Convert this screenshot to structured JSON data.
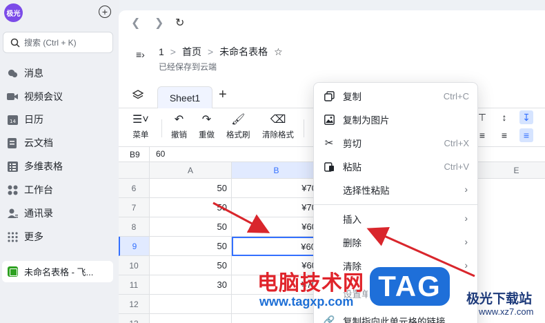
{
  "sidebar": {
    "avatar": "极光",
    "search_placeholder": "搜索 (Ctrl + K)",
    "items": [
      {
        "label": "消息",
        "icon": "chat-icon"
      },
      {
        "label": "视频会议",
        "icon": "video-icon"
      },
      {
        "label": "日历",
        "icon": "calendar-icon"
      },
      {
        "label": "云文档",
        "icon": "cloud-doc-icon"
      },
      {
        "label": "多维表格",
        "icon": "bitable-icon"
      },
      {
        "label": "工作台",
        "icon": "workspace-icon"
      },
      {
        "label": "通讯录",
        "icon": "contacts-icon"
      },
      {
        "label": "更多",
        "icon": "more-icon"
      }
    ],
    "recent_doc": "未命名表格 - 飞..."
  },
  "header": {
    "breadcrumb_num": "1",
    "breadcrumb_home": "首页",
    "breadcrumb_sep": ">",
    "doc_title": "未命名表格",
    "saved_status": "已经保存到云端"
  },
  "tabs": {
    "sheet_name": "Sheet1",
    "add": "+"
  },
  "toolbar": {
    "menu": "菜单",
    "undo": "撤销",
    "redo": "重做",
    "format_painter": "格式刷",
    "clear_format": "清除格式"
  },
  "formula": {
    "cell_ref": "B9",
    "value": "60"
  },
  "grid": {
    "columns": [
      "A",
      "B",
      "E"
    ],
    "rows": [
      {
        "num": "6",
        "a": "50",
        "b": "¥70"
      },
      {
        "num": "7",
        "a": "50",
        "b": "¥70"
      },
      {
        "num": "8",
        "a": "50",
        "b": "¥60"
      },
      {
        "num": "9",
        "a": "50",
        "b": "¥60"
      },
      {
        "num": "10",
        "a": "50",
        "b": "¥60"
      },
      {
        "num": "11",
        "a": "30",
        "b": "¥70"
      },
      {
        "num": "12",
        "a": "",
        "b": ""
      },
      {
        "num": "13",
        "a": "",
        "b": ""
      }
    ]
  },
  "context_menu": {
    "copy": "复制",
    "copy_sc": "Ctrl+C",
    "copy_as_image": "复制为图片",
    "cut": "剪切",
    "cut_sc": "Ctrl+X",
    "paste": "粘贴",
    "paste_sc": "Ctrl+V",
    "paste_special": "选择性粘贴",
    "insert": "插入",
    "delete": "删除",
    "clear": "清除",
    "set_cell": "设置单元格格式",
    "copy_link": "复制指向此单元格的链接"
  },
  "watermark": {
    "cn_title": "电脑技术网",
    "url": "www.tagxp.com",
    "tag": "TAG",
    "site_name": "极光下载站",
    "site_url": "www.xz7.com"
  },
  "colors": {
    "accent": "#3370ff",
    "annotation_arrow": "#d9262c",
    "avatar": "#7b4be8"
  }
}
